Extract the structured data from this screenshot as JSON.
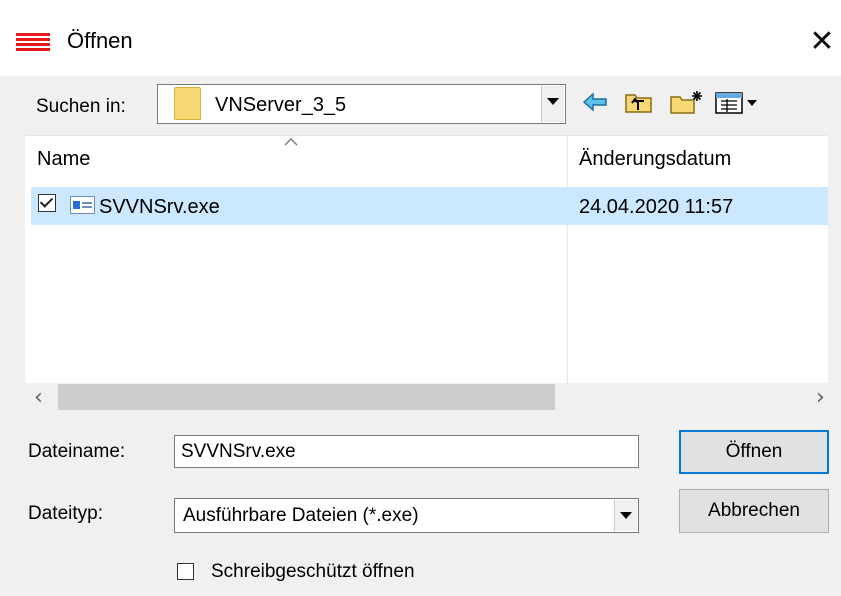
{
  "window": {
    "title": "Öffnen",
    "close_symbol": "✕"
  },
  "look_in": {
    "label": "Suchen in:",
    "value": "VNServer_3_5"
  },
  "toolbar": {
    "back_icon": "arrow-left-icon",
    "up_icon": "folder-up-icon",
    "new_folder_icon": "new-folder-icon",
    "view_menu_icon": "view-menu-icon"
  },
  "file_list": {
    "columns": [
      "Name",
      "Änderungsdatum"
    ],
    "rows": [
      {
        "name": "SVVNSrv.exe",
        "modified": "24.04.2020 11:57",
        "selected": true,
        "checked": true
      }
    ]
  },
  "scrollbar": {
    "left_arrow": "‹",
    "right_arrow": "›"
  },
  "filename": {
    "label": "Dateiname:",
    "value": "SVVNSrv.exe"
  },
  "filetype": {
    "label": "Dateityp:",
    "value": "Ausführbare Dateien (*.exe)"
  },
  "buttons": {
    "open": "Öffnen",
    "cancel": "Abbrechen"
  },
  "readonly": {
    "label": "Schreibgeschützt öffnen",
    "checked": false
  },
  "colors": {
    "accent": "#0078d7",
    "selection": "#cce8ff",
    "app_icon": "#e3191b"
  }
}
